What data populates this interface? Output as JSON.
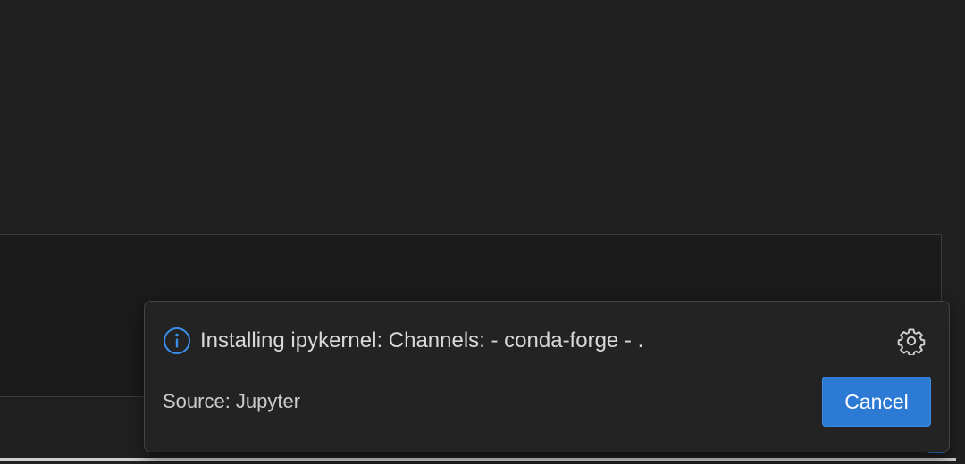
{
  "notification": {
    "message": "Installing ipykernel: Channels: - conda-forge - .",
    "source": "Source: Jupyter",
    "cancel_label": "Cancel",
    "icons": {
      "info": "info-icon",
      "settings": "gear-icon"
    }
  },
  "colors": {
    "background": "#202020",
    "panel": "#1b1b1b",
    "toast": "#232323",
    "accent": "#2c7ad3",
    "info_icon": "#3b8eea",
    "text": "#d9d9d9"
  }
}
